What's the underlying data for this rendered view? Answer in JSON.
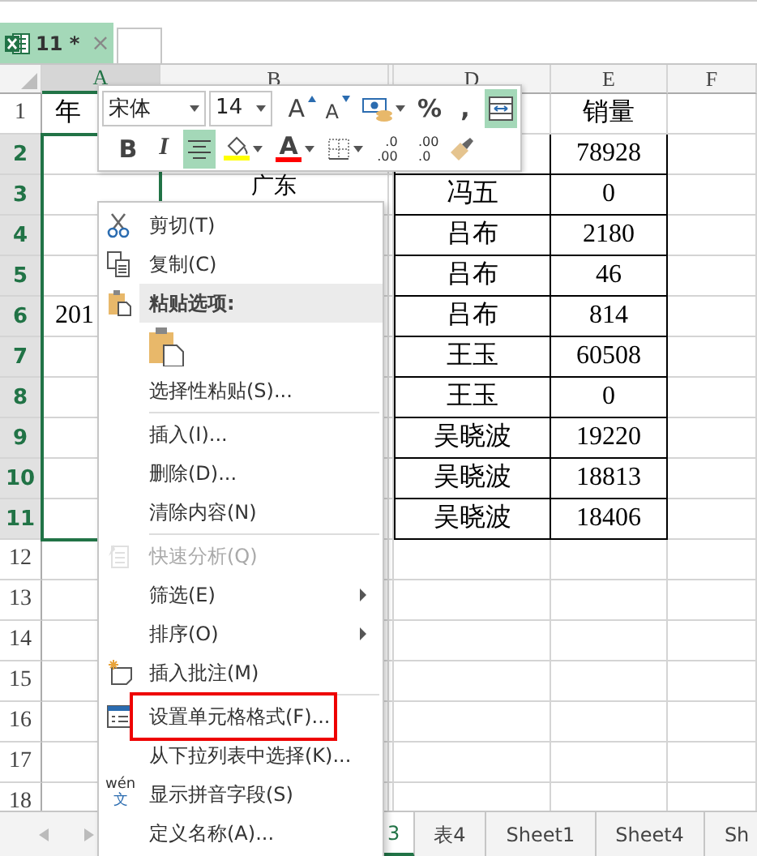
{
  "document_tab": {
    "title": "11 *",
    "close": "×"
  },
  "columns": [
    {
      "label": "A",
      "selected": true
    },
    {
      "label": "B",
      "selected": false
    },
    {
      "label": "D",
      "selected": false
    },
    {
      "label": "E",
      "selected": false
    },
    {
      "label": "F",
      "selected": false
    }
  ],
  "rows": [
    {
      "number": "1",
      "selected": false,
      "bordered": false,
      "cells": {
        "a": "年",
        "e": "销量"
      }
    },
    {
      "number": "2",
      "selected": true,
      "bordered": true,
      "cells": {
        "e": "78928"
      }
    },
    {
      "number": "3",
      "selected": true,
      "bordered": true,
      "cells": {
        "b": "广东",
        "d": "冯五",
        "e": "0"
      }
    },
    {
      "number": "4",
      "selected": true,
      "bordered": true,
      "cells": {
        "d": "吕布",
        "e": "2180"
      }
    },
    {
      "number": "5",
      "selected": true,
      "bordered": true,
      "cells": {
        "d": "吕布",
        "e": "46"
      }
    },
    {
      "number": "6",
      "selected": true,
      "bordered": true,
      "cells": {
        "a": "201",
        "d": "吕布",
        "e": "814"
      }
    },
    {
      "number": "7",
      "selected": true,
      "bordered": true,
      "cells": {
        "d": "王玉",
        "e": "60508"
      }
    },
    {
      "number": "8",
      "selected": true,
      "bordered": true,
      "cells": {
        "d": "王玉",
        "e": "0"
      }
    },
    {
      "number": "9",
      "selected": true,
      "bordered": true,
      "cells": {
        "d": "吴晓波",
        "e": "19220"
      }
    },
    {
      "number": "10",
      "selected": true,
      "bordered": true,
      "cells": {
        "d": "吴晓波",
        "e": "18813"
      }
    },
    {
      "number": "11",
      "selected": true,
      "bordered": true,
      "cells": {
        "d": "吴晓波",
        "e": "18406"
      }
    },
    {
      "number": "12",
      "selected": false,
      "bordered": false,
      "cells": {}
    },
    {
      "number": "13",
      "selected": false,
      "bordered": false,
      "cells": {}
    },
    {
      "number": "14",
      "selected": false,
      "bordered": false,
      "cells": {}
    },
    {
      "number": "15",
      "selected": false,
      "bordered": false,
      "cells": {}
    },
    {
      "number": "16",
      "selected": false,
      "bordered": false,
      "cells": {}
    },
    {
      "number": "17",
      "selected": false,
      "bordered": false,
      "cells": {}
    },
    {
      "number": "18",
      "selected": false,
      "bordered": false,
      "cells": {}
    }
  ],
  "mini_toolbar": {
    "font": "宋体",
    "size": "14",
    "row1": [
      {
        "kind": "grow",
        "label": "A",
        "on": false
      },
      {
        "kind": "shrink",
        "label": "A",
        "on": false
      },
      {
        "kind": "accounting",
        "on": false
      },
      {
        "kind": "percent",
        "label": "%",
        "on": false
      },
      {
        "kind": "comma",
        "label": ",",
        "on": false
      },
      {
        "kind": "wrap",
        "on": true
      }
    ],
    "row2": [
      {
        "kind": "bold",
        "label": "B",
        "on": false
      },
      {
        "kind": "italic",
        "label": "I",
        "on": false
      },
      {
        "kind": "center",
        "on": true
      },
      {
        "kind": "fill",
        "color": "#ffff00",
        "on": false
      },
      {
        "kind": "fontcolor",
        "label": "A",
        "color": "#ff0000",
        "on": false
      },
      {
        "kind": "borders",
        "on": false
      },
      {
        "kind": "decimal",
        "top": ".0",
        "bottom": ".00",
        "on": false
      },
      {
        "kind": "decimal",
        "top": ".00",
        "bottom": ".0",
        "on": false
      },
      {
        "kind": "painter",
        "on": false
      }
    ]
  },
  "menu": {
    "groups": [
      {
        "items": [
          {
            "kind": "cut",
            "label": "剪切(T)",
            "disabled": false,
            "marked": false
          },
          {
            "kind": "copy",
            "label": "复制(C)",
            "disabled": false,
            "marked": false
          },
          {
            "kind": "header",
            "label": "粘贴选项:",
            "disabled": false,
            "marked": false
          },
          {
            "kind": "paste",
            "disabled": false,
            "marked": false
          },
          {
            "kind": "plain",
            "label": "选择性粘贴(S)...",
            "disabled": false,
            "marked": false
          }
        ]
      },
      {
        "items": [
          {
            "kind": "plain",
            "label": "插入(I)...",
            "disabled": false,
            "marked": false
          },
          {
            "kind": "plain",
            "label": "删除(D)...",
            "disabled": false,
            "marked": false
          },
          {
            "kind": "plain",
            "label": "清除内容(N)",
            "disabled": false,
            "marked": false
          }
        ]
      },
      {
        "items": [
          {
            "kind": "analysis",
            "label": "快速分析(Q)",
            "disabled": true,
            "marked": false
          },
          {
            "kind": "submenu",
            "label": "筛选(E)",
            "disabled": false,
            "marked": false
          },
          {
            "kind": "submenu",
            "label": "排序(O)",
            "disabled": false,
            "marked": false
          },
          {
            "kind": "comment",
            "label": "插入批注(M)",
            "disabled": false,
            "marked": false
          }
        ]
      },
      {
        "items": [
          {
            "kind": "format",
            "label": "设置单元格格式(F)...",
            "disabled": false,
            "marked": true
          },
          {
            "kind": "plain",
            "label": "从下拉列表中选择(K)...",
            "disabled": false,
            "marked": false
          },
          {
            "kind": "phonetic",
            "label": "显示拼音字段(S)",
            "icon_top": "wén",
            "icon_bottom": "文",
            "disabled": false,
            "marked": false
          },
          {
            "kind": "plain",
            "label": "定义名称(A)...",
            "disabled": false,
            "marked": false
          }
        ]
      }
    ]
  },
  "sheet_tabs": [
    {
      "label": "3",
      "selected": true
    },
    {
      "label": "表4",
      "selected": false
    },
    {
      "label": "Sheet1",
      "selected": false
    },
    {
      "label": "Sheet4",
      "selected": false
    },
    {
      "label": "Sh",
      "selected": false
    }
  ]
}
